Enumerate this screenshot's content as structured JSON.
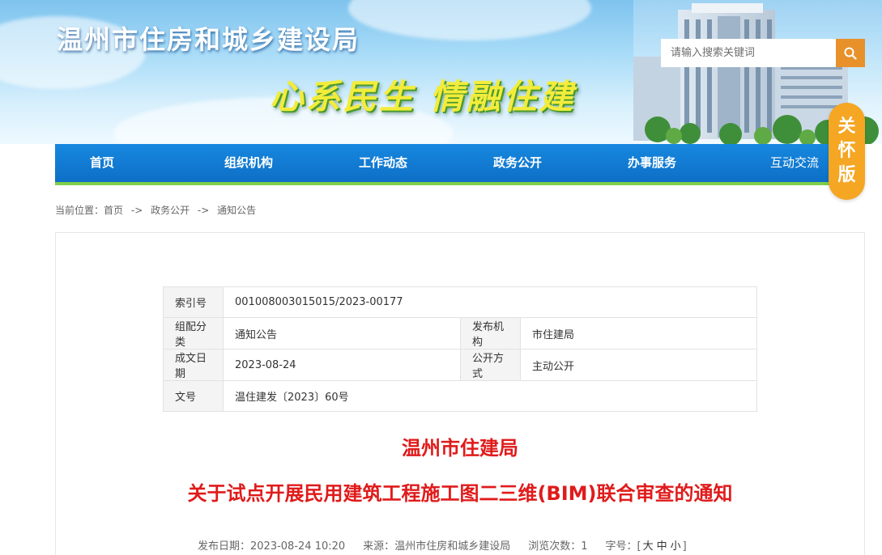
{
  "header": {
    "site_name": "温州市住房和城乡建设局",
    "slogan": "心系民生  情融住建",
    "search_placeholder": "请输入搜索关键词",
    "care_mode": [
      "关",
      "怀",
      "版"
    ]
  },
  "nav": {
    "items": [
      {
        "label": "首页"
      },
      {
        "label": "组织机构"
      },
      {
        "label": "工作动态"
      },
      {
        "label": "政务公开"
      },
      {
        "label": "办事服务"
      },
      {
        "label": "互动交流"
      }
    ]
  },
  "breadcrumb": {
    "prefix": "当前位置：",
    "items": [
      "首页",
      "政务公开",
      "通知公告"
    ],
    "separator": "->"
  },
  "meta": {
    "index_label": "索引号",
    "index_value": "001008003015015/2023-00177",
    "category_label": "组配分类",
    "category_value": "通知公告",
    "publisher_label": "发布机构",
    "publisher_value": "市住建局",
    "date_label": "成文日期",
    "date_value": "2023-08-24",
    "disclosure_label": "公开方式",
    "disclosure_value": "主动公开",
    "doc_no_label": "文号",
    "doc_no_value": "温住建发〔2023〕60号"
  },
  "document": {
    "title_line1": "温州市住建局",
    "title_line2": "关于试点开展民用建筑工程施工图二三维(BIM)联合审查的通知",
    "publish_label": "发布日期：",
    "publish_value": "2023-08-24 10:20",
    "source_label": "来源：",
    "source_value": "温州市住房和城乡建设局",
    "views_label": "浏览次数：",
    "views_value": "1",
    "font_label": "字号：",
    "font_open": "[",
    "font_large": "大",
    "font_medium": "中",
    "font_small": "小",
    "font_close": "]"
  },
  "colors": {
    "nav_blue": "#1788e0",
    "nav_underline": "#7fce4c",
    "search_button": "#e8912a",
    "care_badge": "#f5a623",
    "title_red": "#e01b1b"
  }
}
